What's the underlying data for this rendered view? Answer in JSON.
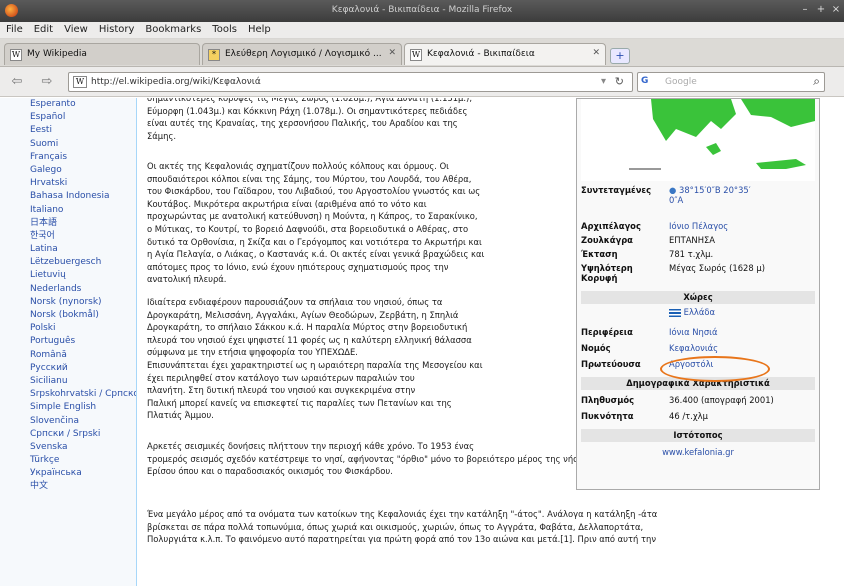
{
  "window": {
    "title": "Κεφαλονιά - Βικιπαίδεια - Mozilla Firefox",
    "controls": [
      "–",
      "+",
      "×"
    ]
  },
  "menu": [
    "File",
    "Edit",
    "View",
    "History",
    "Bookmarks",
    "Tools",
    "Help"
  ],
  "tabs": [
    {
      "label": "My Wikipedia",
      "icon": "W"
    },
    {
      "label": "Ελεύθερη Λογισμικό / Λογισμικό ...",
      "icon": "*"
    },
    {
      "label": "Κεφαλονιά - Βικιπαίδεια",
      "icon": "W"
    }
  ],
  "new_tab": "+",
  "nav": {
    "url": "http://el.wikipedia.org/wiki/Κεφαλονιά",
    "search_placeholder": "Google",
    "search_engine": "G",
    "search_icon": "search-icon"
  },
  "languages": [
    "Esperanto",
    "Español",
    "Eesti",
    "Suomi",
    "Français",
    "Galego",
    "Hrvatski",
    "Bahasa Indonesia",
    "Italiano",
    "日本語",
    "한국어",
    "Latina",
    "Lëtzebuergesch",
    "Lietuvių",
    "Nederlands",
    "Norsk (nynorsk)",
    "Norsk (bokmål)",
    "Polski",
    "Português",
    "Română",
    "Русский",
    "Sicilianu",
    "Srpskohrvatski / Српскохрватски",
    "Simple English",
    "Slovenčina",
    "Српски / Srpski",
    "Svenska",
    "Türkçe",
    "Українська",
    "中文"
  ],
  "article": {
    "p1": [
      "σημαντικότερες κορυφές τις Μέγας Σωρός (1.628μ.), Αγία Δυνατή (1.131μ.),",
      "Εύμορφη (1.043μ.) και Κόκκινη Ράχη (1.078μ.). Οι σημαντικότερες πεδιάδες",
      "είναι αυτές της Κραναίας, της χερσονήσου Παλικής, του Αραδίου και της",
      "Σάμης."
    ],
    "p2": [
      "Οι ακτές της Κεφαλονιάς σχηματίζουν πολλούς κόλπους και όρμους. Οι",
      "σπουδαιότεροι κόλποι είναι της Σάμης, του Μύρτου, του Λουρδά, του Αθέρα,",
      "του Φισκάρδου, του Γαϊδαρου, του Λιβαδιού, του Αργοστολίου γνωστός και ως",
      "Κουτάβος. Μικρότερα ακρωτήρια είναι (αριθμένα από το νότο και",
      "προχωρώντας με ανατολική κατεύθυνση) η Μούντα, η Κάπρος, το Σαρακίνικο,",
      "ο Μύτικας, το Κουτρί, το βορειό Δαφνούδι, στα βορειοδυτικά ο Αθέρας, στο",
      "δυτικό τα Ορθονίσια, η Σκίζα και ο Γερόγομπος και νοτιότερα το Ακρωτήρι και",
      "η Αγία Πελαγία, ο Λιάκας, ο Καστανάς κ.ά. Οι ακτές είναι γενικά βραχώδεις και",
      "απότομες προς το Ιόνιο, ενώ έχουν ηπιότερους σχηματισμούς προς την",
      "ανατολική πλευρά."
    ],
    "p3": [
      "Ιδιαίτερα ενδιαφέρουν παρουσιάζουν τα σπήλαια του νησιού, όπως τα",
      "Δρογκαράτη, Μελισσάνη, Αγγαλάκι, Αγίων Θεοδώρων, Ζερβάτη, η Σπηλιά",
      "Δρογκαράτη, το σπήλαιο Σάκκου κ.ά. Η παραλία Μύρτος στην βορειοδυτική",
      "πλευρά του νησιού έχει ψηφιστεί 11 φορές ως η καλύτερη ελληνική θάλασσα",
      "σύμφωνα με την ετήσια ψηφοφορία του ΥΠΕΧΩΔΕ.",
      "Επισυνάπτεται έχει χαρακτηριστεί ως η ωραιότερη παραλία της Μεσογείου και",
      "έχει περιληφθεί στον κατάλογο των ωραιότερων παραλιών του",
      "πλανήτη. Στη δυτική πλευρά του νησιού και συγκεκριμένα στην",
      "Παλική μπορεί κανείς να επισκεφτεί τις παραλίες των Πετανίων και της",
      "Πλατιάς Άμμου."
    ],
    "p4": [
      "Αρκετές σεισμικές δονήσεις πλήττουν την περιοχή κάθε χρόνο. Το 1953 ένας",
      "τρομερός σεισμός σχεδόν κατέστρεψε το νησί, αφήνοντας \"όρθιο\" μόνο το βορειότερο μέρος της νήσου, την χερσόνησο της",
      "Ερίσου όπου και ο παραδοσιακός οικισμός του Φισκάρδου."
    ],
    "p5": [
      "Ένα μεγάλο μέρος από τα ονόματα των κατοίκων της Κεφαλονιάς έχει την κατάληξη \"-άτος\". Ανάλογα η κατάληξη -άτα",
      "βρίσκεται σε πάρα πολλά τοπωνύμια, όπως χωριά και οικισμούς, χωριών, όπως το Αγγράτα, Φαβάτα, Δελλαπορτάτα,",
      "Πολυργιάτα κ.λ.π. Το φαινόμενο αυτό παρατηρείται για πρώτη φορά από τον 13ο αιώνα και μετά.[1]. Πριν από αυτή την"
    ]
  },
  "infobox": {
    "coords_label": "Συντεταγμένες",
    "coords_value": [
      "38°15′0″Β 20°35′",
      "0″Α"
    ],
    "rows": [
      {
        "k": "Αρχιπέλαγος",
        "v": "Ιόνιο Πέλαγος"
      },
      {
        "k": "Ζουλκάγρα",
        "v": "ΕΠΤΑΝΗΣΑ"
      },
      {
        "k": "Έκταση",
        "v": "781 τ.χλμ."
      },
      {
        "k": "Υψηλότερη Κορυφή",
        "v": "Μέγας Σωρός (1628 μ)"
      }
    ],
    "country_head": "Χώρες",
    "country": "Ελλάδα",
    "admin": [
      {
        "k": "Περιφέρεια",
        "v": "Ιόνια Νησιά"
      },
      {
        "k": "Νομός",
        "v": "Κεφαλονιάς"
      },
      {
        "k": "Πρωτεύουσα",
        "v": "Αργοστόλι"
      }
    ],
    "demo_head": "Δημογραφικά Χαρακτηριστικά",
    "demo": [
      {
        "k": "Πληθυσμός",
        "v": "36.400 (απογραφή 2001)"
      },
      {
        "k": "Πυκνότητα",
        "v": "46 /τ.χλμ"
      }
    ],
    "site_head": "Ιστότοπος",
    "site": "www.kefalonia.gr"
  },
  "colors": {
    "link": "#2a4fa8",
    "highlight_ring": "#e8751a",
    "map_land": "#3ac33a"
  }
}
